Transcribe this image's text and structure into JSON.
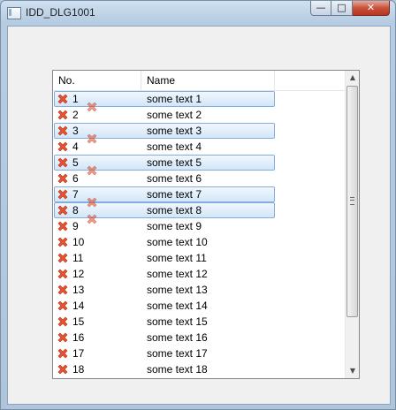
{
  "window": {
    "title": "IDD_DLG1001",
    "minimize_glyph": "—",
    "maximize_glyph": "□",
    "close_glyph": "✕"
  },
  "list": {
    "columns": [
      "No.",
      "Name",
      ""
    ],
    "rows": [
      {
        "no": "1",
        "name": "some text 1",
        "selected": true
      },
      {
        "no": "2",
        "name": "some text 2",
        "selected": false
      },
      {
        "no": "3",
        "name": "some text 3",
        "selected": true
      },
      {
        "no": "4",
        "name": "some text 4",
        "selected": false
      },
      {
        "no": "5",
        "name": "some text 5",
        "selected": true
      },
      {
        "no": "6",
        "name": "some text 6",
        "selected": false
      },
      {
        "no": "7",
        "name": "some text 7",
        "selected": true
      },
      {
        "no": "8",
        "name": "some text 8",
        "selected": true
      },
      {
        "no": "9",
        "name": "some text 9",
        "selected": false
      },
      {
        "no": "10",
        "name": "some text 10",
        "selected": false
      },
      {
        "no": "11",
        "name": "some text 11",
        "selected": false
      },
      {
        "no": "12",
        "name": "some text 12",
        "selected": false
      },
      {
        "no": "13",
        "name": "some text 13",
        "selected": false
      },
      {
        "no": "14",
        "name": "some text 14",
        "selected": false
      },
      {
        "no": "15",
        "name": "some text 15",
        "selected": false
      },
      {
        "no": "16",
        "name": "some text 16",
        "selected": false
      },
      {
        "no": "17",
        "name": "some text 17",
        "selected": false
      },
      {
        "no": "18",
        "name": "some text 18",
        "selected": false
      }
    ],
    "row_icon": "red-x-icon",
    "ghost_icon_rows": [
      2,
      4,
      6,
      8,
      9
    ]
  },
  "scrollbar": {
    "up_glyph": "▲",
    "down_glyph": "▼"
  },
  "colors": {
    "selection_fill": "#d2e6f9",
    "selection_border": "#84acdd",
    "icon_red": "#e8532f"
  }
}
